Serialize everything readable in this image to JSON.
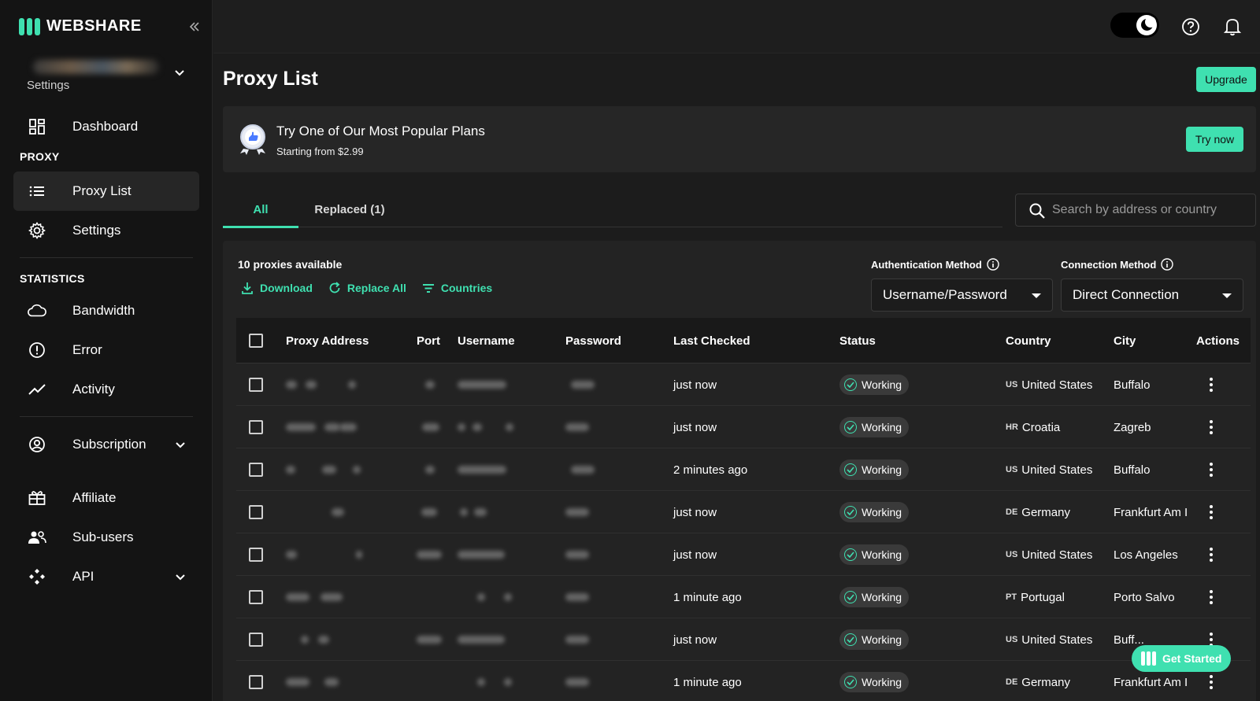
{
  "brand": {
    "name": "WEBSHARE",
    "accent": "#3fe0b0"
  },
  "sidebar": {
    "account_label": "Settings",
    "items": [
      {
        "label": "Dashboard",
        "icon": "dashboard-icon"
      },
      {
        "section": "PROXY"
      },
      {
        "label": "Proxy List",
        "icon": "list-icon",
        "active": true
      },
      {
        "label": "Settings",
        "icon": "gear-icon"
      },
      {
        "section": "STATISTICS"
      },
      {
        "label": "Bandwidth",
        "icon": "cloud-icon"
      },
      {
        "label": "Error",
        "icon": "alert-circle-icon"
      },
      {
        "label": "Activity",
        "icon": "trend-icon"
      },
      {
        "label": "Subscription",
        "icon": "account-circle-icon",
        "expandable": true
      },
      {
        "label": "Affiliate",
        "icon": "gift-icon"
      },
      {
        "label": "Sub-users",
        "icon": "users-icon"
      },
      {
        "label": "API",
        "icon": "api-icon",
        "expandable": true
      }
    ],
    "sections": {
      "proxy": "PROXY",
      "statistics": "STATISTICS"
    },
    "labels": {
      "dashboard": "Dashboard",
      "proxy_list": "Proxy List",
      "settings": "Settings",
      "bandwidth": "Bandwidth",
      "error": "Error",
      "activity": "Activity",
      "subscription": "Subscription",
      "affiliate": "Affiliate",
      "subusers": "Sub-users",
      "api": "API"
    }
  },
  "header": {
    "theme": "dark"
  },
  "page": {
    "title": "Proxy List",
    "upgrade_label": "Upgrade",
    "promo": {
      "title": "Try One of Our Most Popular Plans",
      "subtitle": "Starting from $2.99",
      "cta": "Try now"
    },
    "tabs": [
      {
        "label": "All",
        "active": true
      },
      {
        "label": "Replaced (1)",
        "active": false
      }
    ],
    "search_placeholder": "Search by address or country",
    "available": "10 proxies available",
    "actions": {
      "download": "Download",
      "replace_all": "Replace All",
      "countries": "Countries"
    },
    "auth_method": {
      "label": "Authentication Method",
      "value": "Username/Password"
    },
    "connection_method": {
      "label": "Connection Method",
      "value": "Direct Connection"
    }
  },
  "table": {
    "columns": [
      "Proxy Address",
      "Port",
      "Username",
      "Password",
      "Last Checked",
      "Status",
      "Country",
      "City",
      "Actions"
    ],
    "rows": [
      {
        "last_checked": "just now",
        "status": "Working",
        "cc": "US",
        "country": "United States",
        "city": "Buffalo"
      },
      {
        "last_checked": "just now",
        "status": "Working",
        "cc": "HR",
        "country": "Croatia",
        "city": "Zagreb"
      },
      {
        "last_checked": "2 minutes ago",
        "status": "Working",
        "cc": "US",
        "country": "United States",
        "city": "Buffalo"
      },
      {
        "last_checked": "just now",
        "status": "Working",
        "cc": "DE",
        "country": "Germany",
        "city": "Frankfurt Am I"
      },
      {
        "last_checked": "just now",
        "status": "Working",
        "cc": "US",
        "country": "United States",
        "city": "Los Angeles"
      },
      {
        "last_checked": "1 minute ago",
        "status": "Working",
        "cc": "PT",
        "country": "Portugal",
        "city": "Porto Salvo"
      },
      {
        "last_checked": "just now",
        "status": "Working",
        "cc": "US",
        "country": "United States",
        "city": "Buff..."
      },
      {
        "last_checked": "1 minute ago",
        "status": "Working",
        "cc": "DE",
        "country": "Germany",
        "city": "Frankfurt Am I"
      }
    ]
  },
  "get_started": "Get Started"
}
